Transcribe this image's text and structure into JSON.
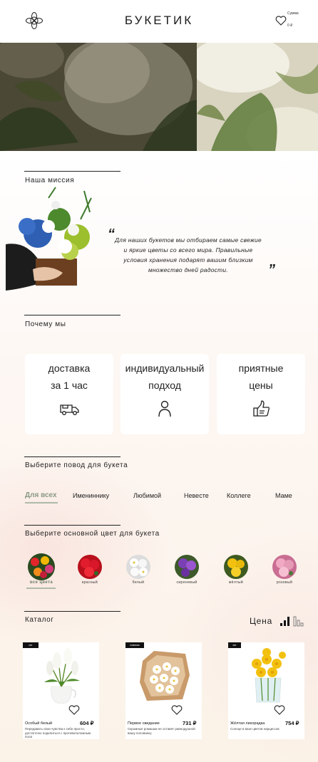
{
  "header": {
    "brand": "БУКЕТИК",
    "cart_label": "Сумма",
    "cart_sum": "0 ₽"
  },
  "mission": {
    "title": "Наша миссия",
    "text": "Для наших букетов мы отбираем самые свежие и яркие цветы со всего мира. Правильные условия хранения подарят вашим близким множество дней радости.",
    "quote_open": "“",
    "quote_close": "”"
  },
  "why_us": {
    "title": "Почему мы",
    "cards": [
      {
        "line1": "доставка",
        "line2": "за 1 час",
        "icon": "delivery-truck-icon"
      },
      {
        "line1": "индивидуальный",
        "line2": "подход",
        "icon": "person-icon"
      },
      {
        "line1": "приятные",
        "line2": "цены",
        "icon": "thumbs-up-icon"
      }
    ]
  },
  "occasions": {
    "title": "Выберите повод для букета",
    "items": [
      "Для всех",
      "Имениннику",
      "Любимой",
      "Невесте",
      "Коллеге",
      "Маме"
    ],
    "selected": "Для всех"
  },
  "colors": {
    "title": "Выберите основной цвет для букета",
    "items": [
      {
        "label": "все цвета",
        "color": "#c0392b"
      },
      {
        "label": "красный",
        "color": "#d8182a"
      },
      {
        "label": "белый",
        "color": "#f2f2f2"
      },
      {
        "label": "сиреневый",
        "color": "#7b3fb5"
      },
      {
        "label": "жёлтый",
        "color": "#e8b90d"
      },
      {
        "label": "розовый",
        "color": "#e59ab6"
      }
    ],
    "selected": "все цвета"
  },
  "catalog": {
    "title": "Каталог",
    "price_sort_label": "Цена",
    "products": [
      {
        "badge": "хит",
        "name": "Особый белый",
        "price": "604 ₽",
        "desc": "Передавать свои чувства к себе просто, достаточно поделиться с противоположным пола"
      },
      {
        "badge": "новинка",
        "name": "Первое свидание",
        "price": "731 ₽",
        "desc": "Скромные ромашки не оставят равнодушной вашу половинку"
      },
      {
        "badge": "хит",
        "name": "Жёлтая лихорадка",
        "price": "754 ₽",
        "desc": "Солнце в вазе цветов нарциссов"
      }
    ]
  }
}
